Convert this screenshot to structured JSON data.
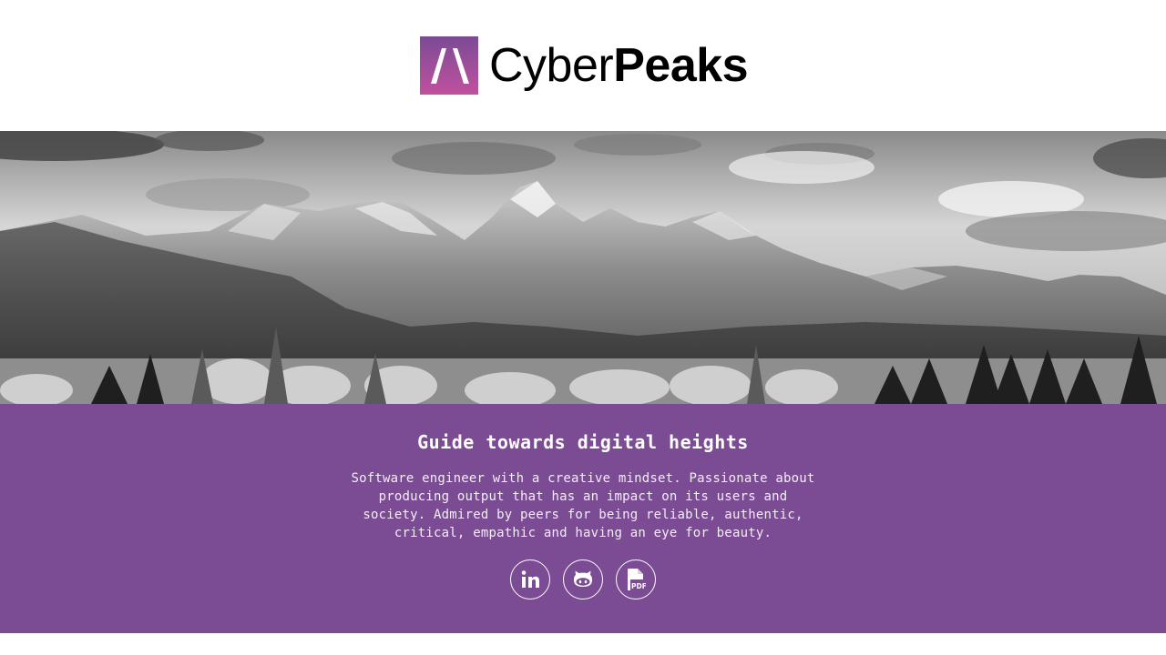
{
  "header": {
    "logo_light": "Cyber",
    "logo_bold": "Peaks",
    "logo_icon": "mountain-peak-logo",
    "brand_gradient": [
      "#7b4b94",
      "#c44f9e"
    ]
  },
  "hero": {
    "image": "grayscale mountain range with forest"
  },
  "intro": {
    "tagline": "Guide towards digital heights",
    "bio": "Software engineer with a creative mindset. Passionate about producing output that has an impact on its users and society. Admired by peers for being reliable, authentic, critical, empathic and having an eye for beauty.",
    "band_color": "#7b4b94"
  },
  "socials": [
    {
      "icon": "linkedin-icon"
    },
    {
      "icon": "github-icon"
    },
    {
      "icon": "pdf-icon"
    }
  ],
  "next_section": {
    "title": ""
  }
}
